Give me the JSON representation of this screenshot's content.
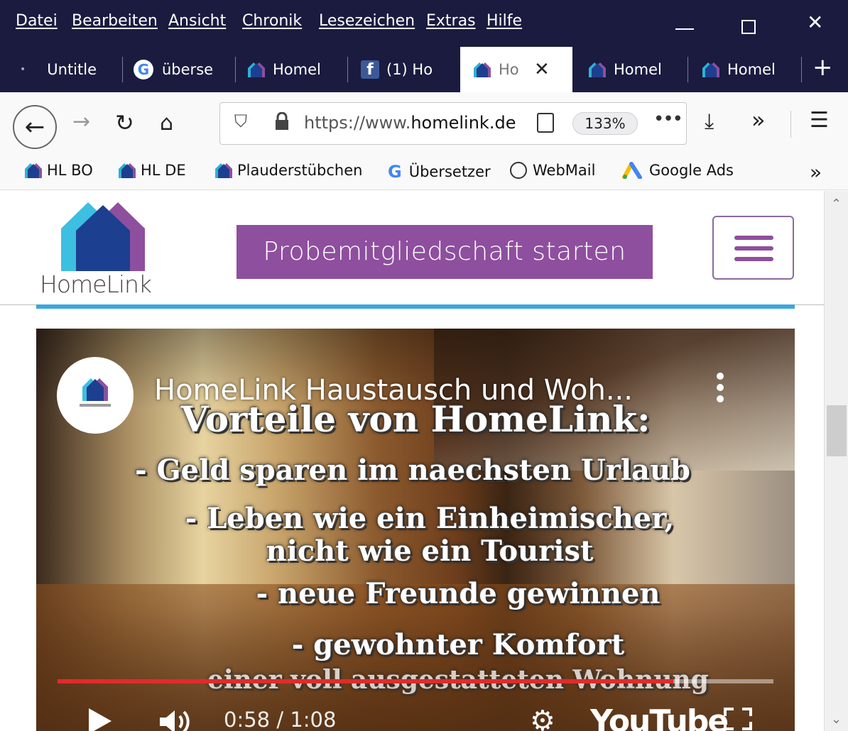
{
  "menubar": {
    "items": [
      "Datei",
      "Bearbeiten",
      "Ansicht",
      "Chronik",
      "Lesezeichen",
      "Extras",
      "Hilfe"
    ]
  },
  "tabs": [
    {
      "label": "Untitle"
    },
    {
      "label": "überse"
    },
    {
      "label": "Homel"
    },
    {
      "label": "(1) Ho"
    },
    {
      "label": "Ho"
    },
    {
      "label": "Homel"
    },
    {
      "label": "Homel"
    }
  ],
  "navbar": {
    "url_prefix": "https://www.",
    "url_domain": "homelink.de",
    "zoom": "133%"
  },
  "bookmarks": [
    "HL BO",
    "HL DE",
    "Plauderstübchen",
    "Übersetzer",
    "WebMail",
    "Google Ads"
  ],
  "site": {
    "logo_text": "HomeLink",
    "trial_button": "Probemitgliedschaft starten"
  },
  "video": {
    "title": "HomeLink Haustausch und Woh...",
    "overlay": [
      "Vorteile von HomeLink:",
      "- Geld sparen im naechsten Urlaub",
      "- Leben wie ein Einheimischer,",
      "nicht wie ein Tourist",
      "- neue Freunde gewinnen",
      "- gewohnter Komfort",
      "einer voll ausgestatteten Wohnung"
    ],
    "time": "0:58 / 1:08",
    "progress": 0.86,
    "youtube_label": "YouTube"
  },
  "colors": {
    "chrome_dark": "#1a1b3f",
    "brand_purple": "#8e4f9e",
    "brand_blue": "#3aa7dd",
    "progress_red": "#e12b2b"
  }
}
